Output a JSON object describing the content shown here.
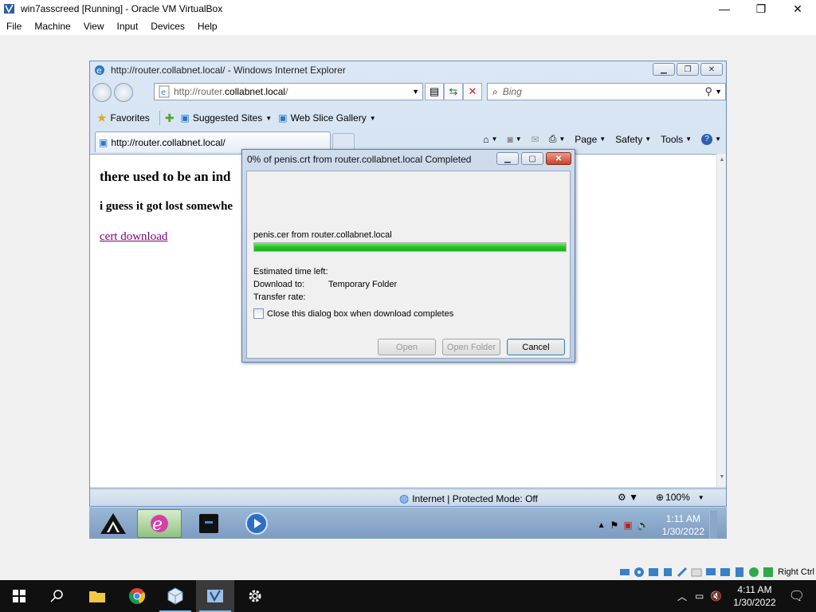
{
  "vbox": {
    "title": "win7asscreed [Running] - Oracle VM VirtualBox",
    "menu": [
      "File",
      "Machine",
      "View",
      "Input",
      "Devices",
      "Help"
    ],
    "host_key": "Right Ctrl"
  },
  "ie": {
    "window_title": "http://router.collabnet.local/ - Windows Internet Explorer",
    "address_prefix": "http://router.",
    "address_domain": "collabnet.local",
    "address_suffix": "/",
    "search_placeholder": "Bing",
    "favorites_label": "Favorites",
    "suggested_sites": "Suggested Sites",
    "web_slice": "Web Slice Gallery",
    "tab_label": "http://router.collabnet.local/",
    "commands": [
      "Page",
      "Safety",
      "Tools"
    ],
    "zone_text": "Internet | Protected Mode: Off",
    "zoom": "100%"
  },
  "page": {
    "heading": "there used to be an ind",
    "subheading": "i guess it got lost somewhe",
    "link": "cert download"
  },
  "dialog": {
    "title": "0% of penis.crt from router.collabnet.local Completed",
    "file_line": "penis.cer from router.collabnet.local",
    "progress": 1.0,
    "est_time_label": "Estimated time left:",
    "download_to_label": "Download to:",
    "download_to_value": "Temporary Folder",
    "transfer_rate_label": "Transfer rate:",
    "checkbox_label": "Close this dialog box when download completes",
    "buttons": {
      "open": "Open",
      "open_folder": "Open Folder",
      "cancel": "Cancel"
    }
  },
  "guest_taskbar": {
    "time": "1:11 AM",
    "date": "1/30/2022"
  },
  "host_taskbar": {
    "time": "4:11 AM",
    "date": "1/30/2022"
  },
  "colors": {
    "progress": "#22c522",
    "link_visited": "#800080",
    "host_taskbar": "#101010"
  }
}
